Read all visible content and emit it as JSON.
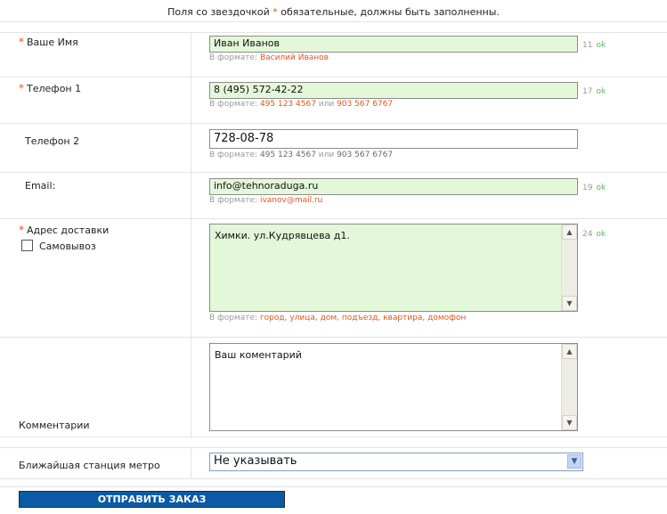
{
  "notice": {
    "before": "Поля со звездочкой ",
    "star": "*",
    "after": " обязательные, должны быть заполненны."
  },
  "required_mark": "*",
  "fields": {
    "name": {
      "label": "Ваше Имя",
      "value": "Иван Иванов",
      "hint_prefix": "В формате: ",
      "hint_example": "Василий Иванов",
      "count": "11",
      "status": "ok"
    },
    "phone1": {
      "label": "Телефон 1",
      "value": "8 (495) 572-42-22",
      "hint_prefix": "В формате: ",
      "hint_example1": "495 123 4567",
      "hint_or": " или ",
      "hint_example2": "903 567 6767",
      "count": "17",
      "status": "ok"
    },
    "phone2": {
      "label": "Телефон 2",
      "value": "728-08-78",
      "hint_prefix": "В формате: ",
      "hint_example1": "495 123 4567",
      "hint_or": " или ",
      "hint_example2": "903 567 6767"
    },
    "email": {
      "label": "Email:",
      "value": "info@tehnoraduga.ru",
      "hint_prefix": "В формате: ",
      "hint_example": "ivanov@mail.ru",
      "count": "19",
      "status": "ok"
    },
    "address": {
      "label": "Адрес доставки",
      "pickup_label": "Самовывоз",
      "pickup_checked": false,
      "value": "Химки. ул.Кудрявцева д1.",
      "hint_prefix": "В формате: ",
      "hint_example": "город, улица, дом, подъезд, квартира, домофон",
      "count": "24",
      "status": "ok"
    },
    "comment": {
      "label": "Комментарии",
      "value": "Ваш коментарий"
    },
    "metro": {
      "label": "Ближайшая станция метро",
      "selected": "Не указывать"
    }
  },
  "submit_label": "ОТПРАВИТЬ ЗАКАЗ",
  "icons": {
    "scroll_up": "▲",
    "scroll_down": "▼",
    "select_arrow": "▼"
  },
  "colors": {
    "required": "#e8541a",
    "valid_bg": "#e3f8d8",
    "ok": "#5cb85c",
    "submit_bg": "#0a5aa5"
  }
}
